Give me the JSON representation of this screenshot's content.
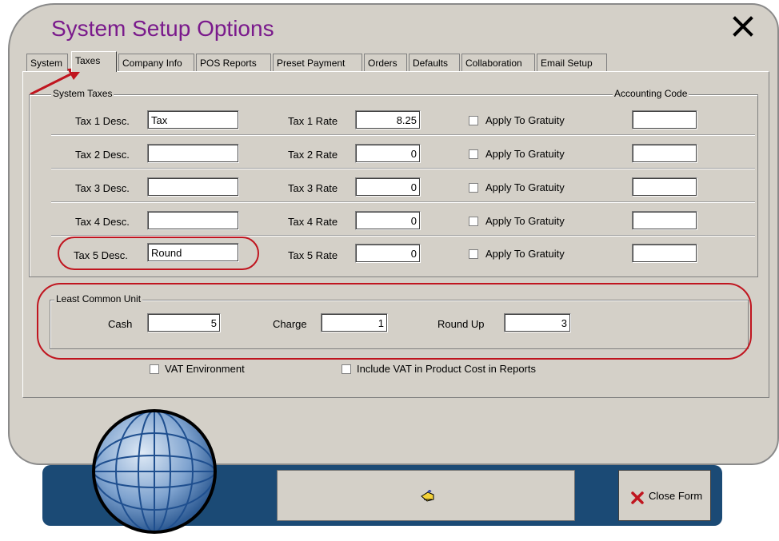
{
  "window": {
    "title": "System Setup Options",
    "close_glyph": "✕"
  },
  "tabs": [
    {
      "label": "System",
      "active": false
    },
    {
      "label": "Taxes",
      "active": true
    },
    {
      "label": "Company Info",
      "active": false
    },
    {
      "label": "POS Reports",
      "active": false
    },
    {
      "label": "Preset Payment",
      "active": false
    },
    {
      "label": "Orders",
      "active": false
    },
    {
      "label": "Defaults",
      "active": false
    },
    {
      "label": "Collaboration",
      "active": false
    },
    {
      "label": "Email Setup",
      "active": false
    }
  ],
  "system_taxes": {
    "group_label": "System Taxes",
    "accounting_code_header": "Accounting Code",
    "rows": [
      {
        "desc_label": "Tax 1 Desc.",
        "desc_value": "Tax",
        "rate_label": "Tax 1 Rate",
        "rate_value": "8.25",
        "gratuity_label": "Apply To Gratuity",
        "gratuity_checked": false,
        "accounting_code": ""
      },
      {
        "desc_label": "Tax 2 Desc.",
        "desc_value": "",
        "rate_label": "Tax 2 Rate",
        "rate_value": "0",
        "gratuity_label": "Apply To Gratuity",
        "gratuity_checked": false,
        "accounting_code": ""
      },
      {
        "desc_label": "Tax 3 Desc.",
        "desc_value": "",
        "rate_label": "Tax 3 Rate",
        "rate_value": "0",
        "gratuity_label": "Apply To Gratuity",
        "gratuity_checked": false,
        "accounting_code": ""
      },
      {
        "desc_label": "Tax 4 Desc.",
        "desc_value": "",
        "rate_label": "Tax 4 Rate",
        "rate_value": "0",
        "gratuity_label": "Apply To Gratuity",
        "gratuity_checked": false,
        "accounting_code": ""
      },
      {
        "desc_label": "Tax 5 Desc.",
        "desc_value": "Round",
        "rate_label": "Tax 5 Rate",
        "rate_value": "0",
        "gratuity_label": "Apply To Gratuity",
        "gratuity_checked": false,
        "accounting_code": ""
      }
    ]
  },
  "least_common_unit": {
    "group_label": "Least Common Unit",
    "cash_label": "Cash",
    "cash_value": "5",
    "charge_label": "Charge",
    "charge_value": "1",
    "round_up_label": "Round Up",
    "round_up_value": "3"
  },
  "options": {
    "vat_environment_label": "VAT Environment",
    "vat_environment_checked": false,
    "include_vat_label": "Include VAT in Product Cost in Reports",
    "include_vat_checked": false
  },
  "footer": {
    "close_form_label": "Close Form",
    "close_form_icon": "red-x-icon",
    "action_icon": "pointing-hand-icon"
  },
  "colors": {
    "title": "#7a1a8c",
    "annotation_red": "#c0151f",
    "bottom_bar": "#1b4a75",
    "window_bg": "#d4d0c8"
  }
}
